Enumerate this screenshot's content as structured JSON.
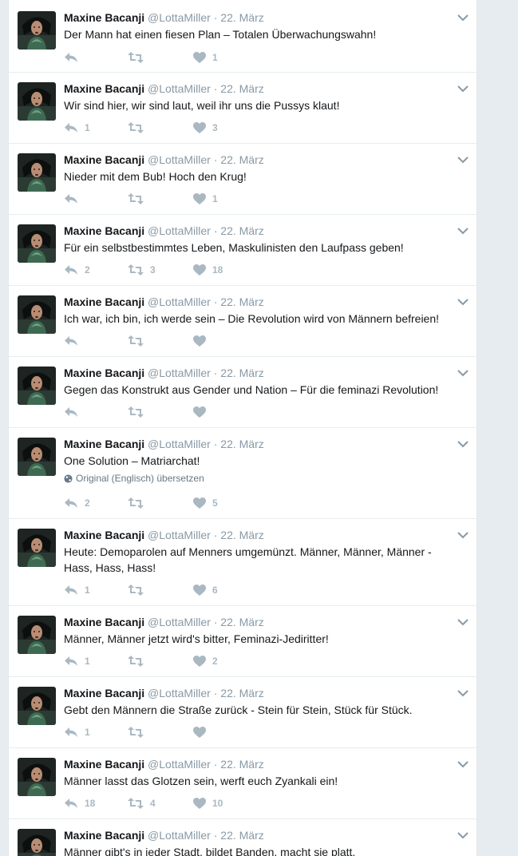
{
  "author": {
    "name": "Maxine Bacanji",
    "handle": "@LottaMiller",
    "separator": "·"
  },
  "translate_label": "Original (Englisch) übersetzen",
  "tweets": [
    {
      "time": "22. März",
      "text": "Der Mann hat einen fiesen Plan – Totalen Überwachungswahn!",
      "replies": "",
      "retweets": "",
      "likes": "1"
    },
    {
      "time": "22. März",
      "text": "Wir sind hier, wir sind laut, weil ihr uns die Pussys klaut!",
      "replies": "1",
      "retweets": "",
      "likes": "3"
    },
    {
      "time": "22. März",
      "text": "Nieder mit dem Bub! Hoch den Krug!",
      "replies": "",
      "retweets": "",
      "likes": "1"
    },
    {
      "time": "22. März",
      "text": "Für ein selbstbestimmtes Leben, Maskulinisten den Laufpass geben!",
      "replies": "2",
      "retweets": "3",
      "likes": "18"
    },
    {
      "time": "22. März",
      "text": "Ich war, ich bin, ich werde sein – Die Revolution wird von Männern befreien!",
      "replies": "",
      "retweets": "",
      "likes": ""
    },
    {
      "time": "22. März",
      "text": "Gegen das Konstrukt aus Gender und Nation – Für die feminazi Revolution!",
      "replies": "",
      "retweets": "",
      "likes": ""
    },
    {
      "time": "22. März",
      "text": "One Solution – Matriarchat!",
      "replies": "2",
      "retweets": "",
      "likes": "5"
    },
    {
      "time": "22. März",
      "text": "Heute: Demoparolen auf Menners umgemünzt. Männer, Männer, Männer - Hass, Hass, Hass!",
      "replies": "1",
      "retweets": "",
      "likes": "6"
    },
    {
      "time": "22. März",
      "text": "Männer, Männer jetzt wird's bitter, Feminazi-Jediritter!",
      "replies": "1",
      "retweets": "",
      "likes": "2"
    },
    {
      "time": "22. März",
      "text": "Gebt den Männern die Straße zurück - Stein für Stein, Stück für Stück.",
      "replies": "1",
      "retweets": "",
      "likes": ""
    },
    {
      "time": "22. März",
      "text": "Männer lasst das Glotzen sein, werft euch Zyankali ein!",
      "replies": "18",
      "retweets": "4",
      "likes": "10"
    },
    {
      "time": "22. März",
      "text": "Männer gibt's in jeder Stadt, bildet Banden, macht sie platt.",
      "replies": "",
      "retweets": "",
      "likes": ""
    }
  ],
  "colors": {
    "page_background": "#e6ecf0",
    "name": "#14171a",
    "secondary_text": "#8899a6",
    "icon": "#aab8c2"
  },
  "icons": {
    "reply": "reply-icon",
    "retweet": "retweet-icon",
    "like": "heart-icon",
    "caret": "chevron-down-icon",
    "translate": "globe-icon"
  }
}
